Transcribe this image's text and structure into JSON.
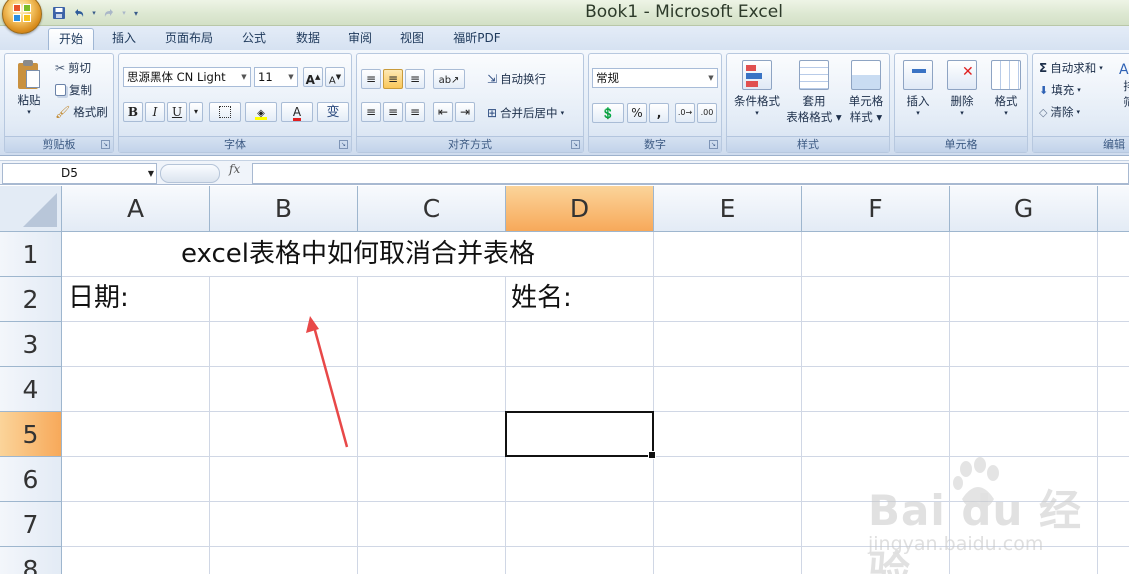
{
  "window": {
    "title": "Book1 - Microsoft Excel"
  },
  "tabs": [
    "开始",
    "插入",
    "页面布局",
    "公式",
    "数据",
    "审阅",
    "视图",
    "福昕PDF"
  ],
  "active_tab": "开始",
  "clipboard": {
    "paste": "粘贴",
    "cut": "剪切",
    "copy": "复制",
    "format_painter": "格式刷",
    "group": "剪贴板"
  },
  "font": {
    "name": "思源黑体 CN Light",
    "size": "11",
    "bold": "B",
    "italic": "I",
    "underline": "U",
    "group": "字体"
  },
  "alignment": {
    "wrap": "自动换行",
    "merge": "合并后居中",
    "group": "对齐方式"
  },
  "number": {
    "format": "常规",
    "percent": "%",
    "comma": ",",
    "group": "数字"
  },
  "styles": {
    "conditional": "条件格式",
    "table1": "套用",
    "table2": "表格格式",
    "cell1": "单元格",
    "cell2": "样式",
    "group": "样式"
  },
  "cells": {
    "insert": "插入",
    "delete": "删除",
    "format": "格式",
    "group": "单元格"
  },
  "editing": {
    "autosum": "自动求和",
    "fill": "填充",
    "clear": "清除",
    "sort1": "排",
    "sort2": "筛",
    "group": "编辑"
  },
  "formula_bar": {
    "name_box": "D5",
    "fx": "fx",
    "content": ""
  },
  "columns": [
    "A",
    "B",
    "C",
    "D",
    "E",
    "F",
    "G"
  ],
  "selected_column": "D",
  "rows": [
    "1",
    "2",
    "3",
    "4",
    "5",
    "6",
    "7",
    "8"
  ],
  "selected_row": "5",
  "cells_content": {
    "title": "excel表格中如何取消合并表格",
    "date_label": "日期:",
    "name_label": "姓名:"
  },
  "watermark": {
    "brand": "Bai du 经验",
    "url": "jingyan.baidu.com"
  },
  "colors": {
    "accent": "#f7a95a",
    "arrow": "#e84848",
    "ribbon": "#dfe9f5"
  }
}
